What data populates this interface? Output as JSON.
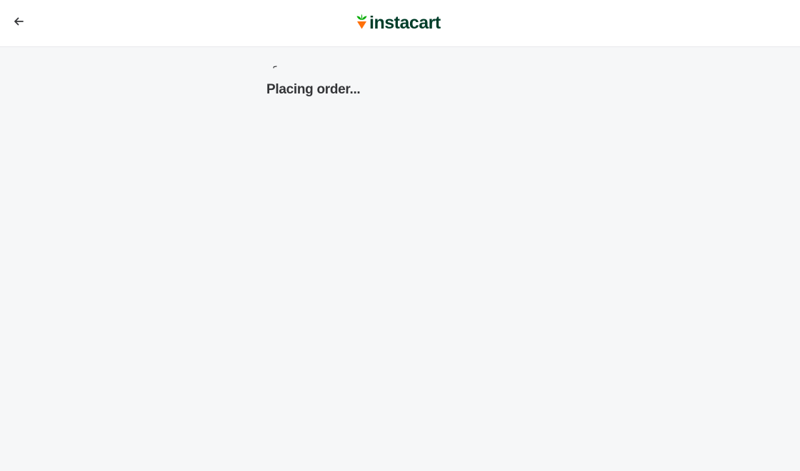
{
  "header": {
    "back_icon": "arrow-left-icon",
    "logo_icon": "carrot-icon",
    "logo_text": "instacart"
  },
  "main": {
    "status_text": "Placing order..."
  },
  "colors": {
    "brand_dark": "#003d29",
    "carrot_orange": "#ff7009",
    "carrot_green": "#0aad0a",
    "background": "#f6f7f8",
    "text": "#343538"
  }
}
